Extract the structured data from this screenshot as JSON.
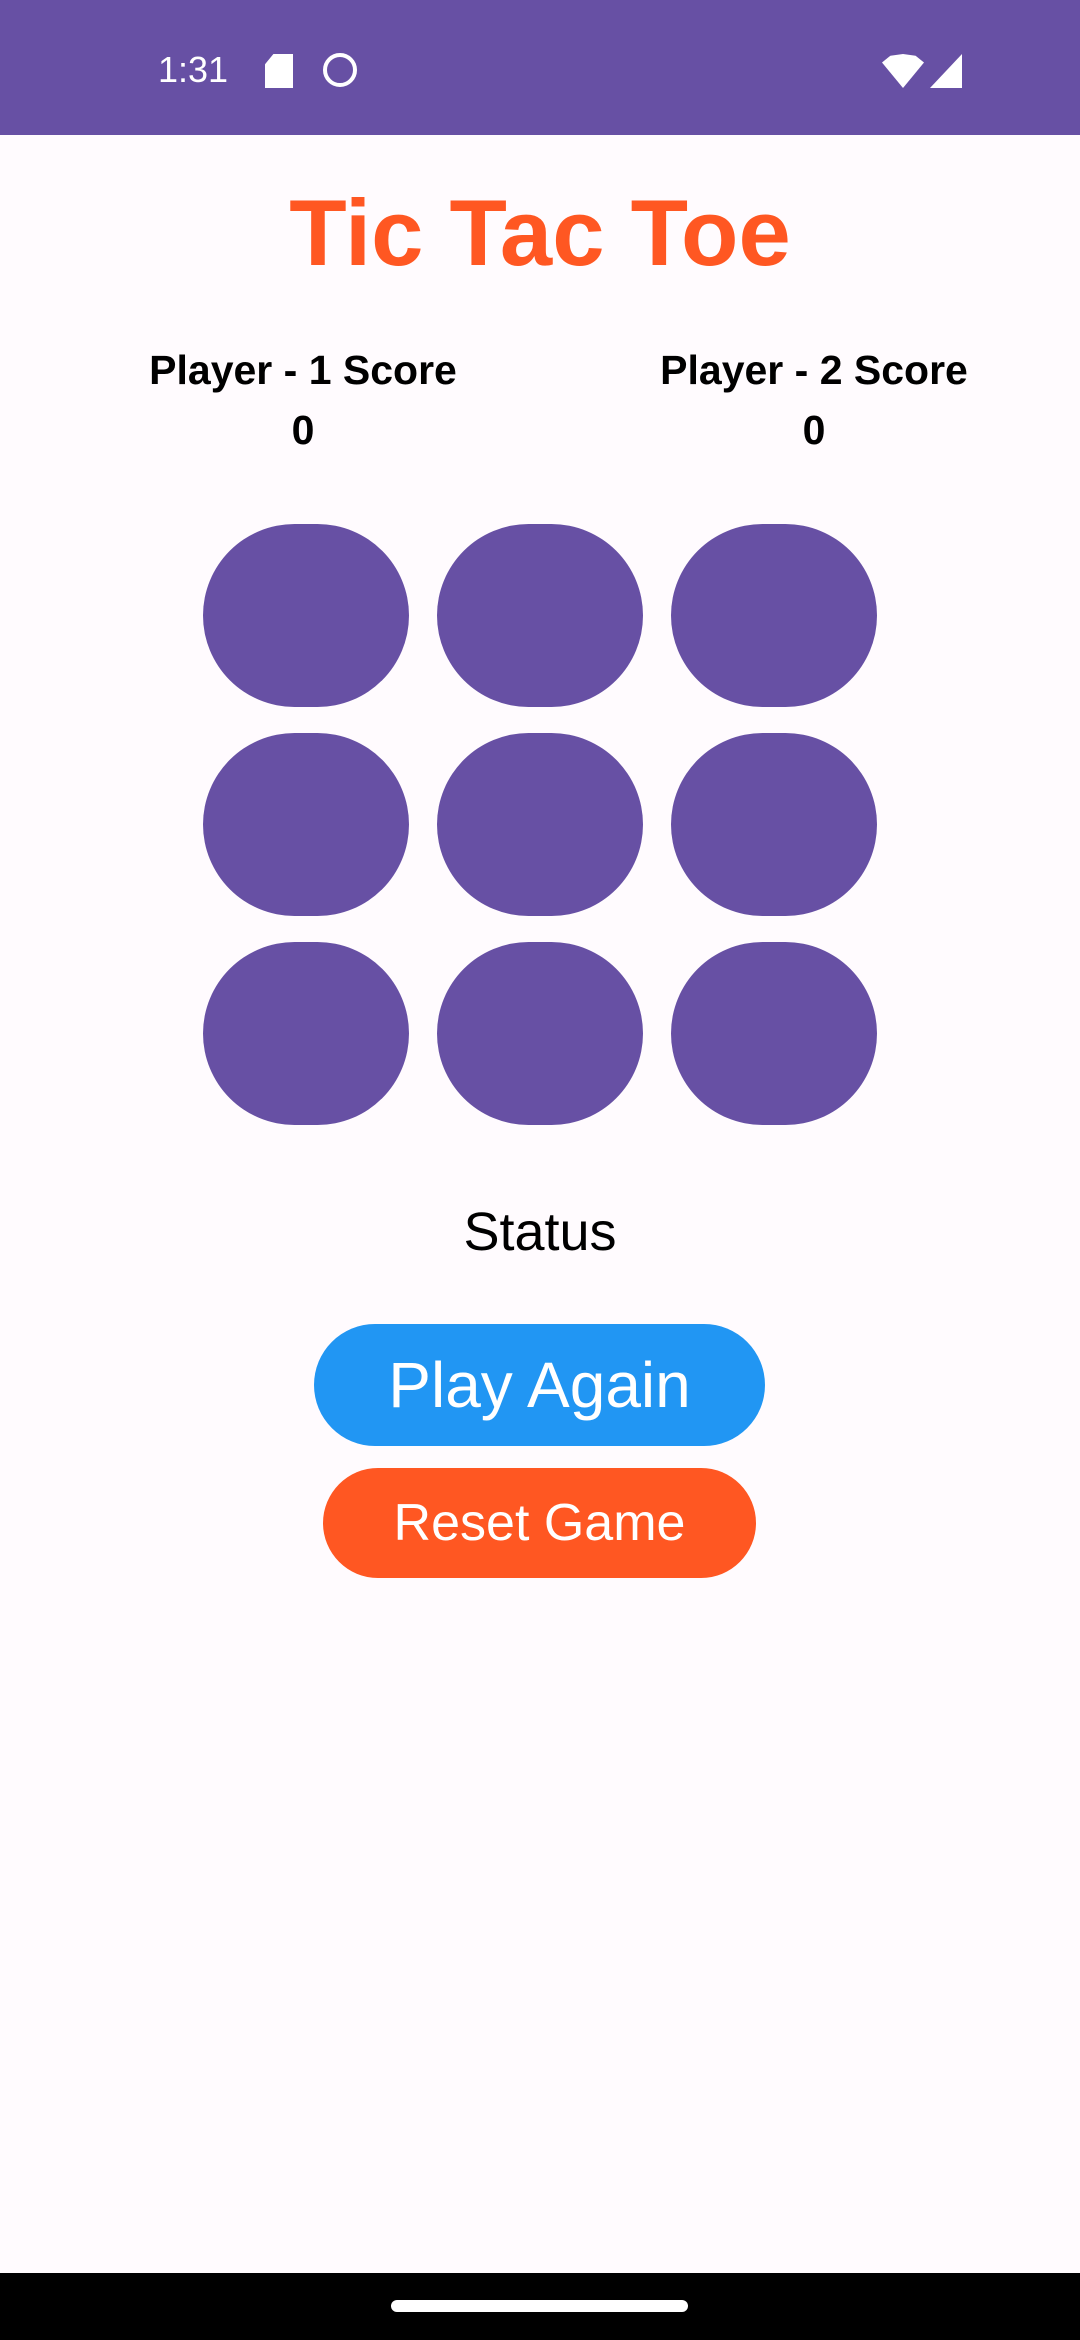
{
  "status_bar": {
    "time": "1:31",
    "icons": [
      "sd-card-icon",
      "notification-cat-icon",
      "wifi-icon",
      "signal-icon"
    ]
  },
  "app": {
    "title": "Tic Tac Toe"
  },
  "scores": {
    "player1": {
      "label": "Player - 1 Score",
      "value": "0"
    },
    "player2": {
      "label": "Player - 2 Score",
      "value": "0"
    }
  },
  "board": {
    "cells": [
      "",
      "",
      "",
      "",
      "",
      "",
      "",
      "",
      ""
    ]
  },
  "status": "Status",
  "buttons": {
    "play_again": "Play Again",
    "reset_game": "Reset Game"
  },
  "colors": {
    "primary": "#6750A4",
    "title": "#FF5722",
    "play_again": "#2196F3",
    "reset": "#FF5722",
    "background": "#FFFBFE"
  }
}
